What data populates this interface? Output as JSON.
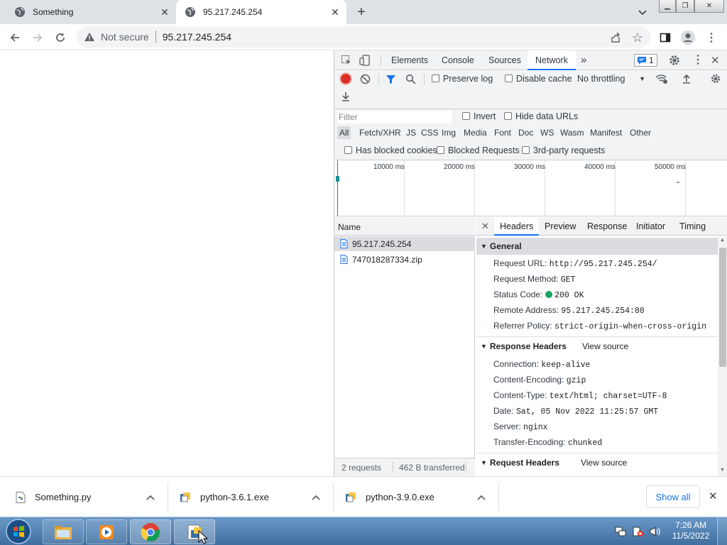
{
  "tabs": [
    {
      "title": "Something"
    },
    {
      "title": "95.217.245.254"
    }
  ],
  "addressbar": {
    "security": "Not secure",
    "url": "95.217.245.254"
  },
  "devtools": {
    "panels": [
      "Elements",
      "Console",
      "Sources",
      "Network"
    ],
    "active_panel": "Network",
    "issue_count": "1",
    "controls": {
      "preserve_log": "Preserve log",
      "disable_cache": "Disable cache",
      "throttling": "No throttling"
    },
    "filter": {
      "placeholder": "Filter",
      "invert": "Invert",
      "hide_data_urls": "Hide data URLs"
    },
    "types": [
      "All",
      "Fetch/XHR",
      "JS",
      "CSS",
      "Img",
      "Media",
      "Font",
      "Doc",
      "WS",
      "Wasm",
      "Manifest",
      "Other"
    ],
    "blocked": {
      "cookies": "Has blocked cookies",
      "requests": "Blocked Requests",
      "third_party": "3rd-party requests"
    },
    "timeline_ticks": [
      "10000 ms",
      "20000 ms",
      "30000 ms",
      "40000 ms",
      "50000 ms"
    ],
    "requests": {
      "column_name": "Name",
      "items": [
        "95.217.245.254",
        "747018287334.zip"
      ],
      "summary": "2 requests",
      "transferred": "462 B transferred"
    },
    "detail_tabs": [
      "Headers",
      "Preview",
      "Response",
      "Initiator",
      "Timing"
    ],
    "general": {
      "title": "General",
      "request_url_label": "Request URL:",
      "request_url": "http://95.217.245.254/",
      "method_label": "Request Method:",
      "method": "GET",
      "status_label": "Status Code:",
      "status": "200 OK",
      "status_color": "#1aa260",
      "remote_label": "Remote Address:",
      "remote": "95.217.245.254:80",
      "referrer_label": "Referrer Policy:",
      "referrer": "strict-origin-when-cross-origin"
    },
    "response_headers": {
      "title": "Response Headers",
      "view_source": "View source",
      "rows": [
        {
          "k": "Connection:",
          "v": "keep-alive"
        },
        {
          "k": "Content-Encoding:",
          "v": "gzip"
        },
        {
          "k": "Content-Type:",
          "v": "text/html; charset=UTF-8"
        },
        {
          "k": "Date:",
          "v": "Sat, 05 Nov 2022 11:25:57 GMT"
        },
        {
          "k": "Server:",
          "v": "nginx"
        },
        {
          "k": "Transfer-Encoding:",
          "v": "chunked"
        }
      ]
    },
    "request_headers": {
      "title": "Request Headers",
      "view_source": "View source"
    }
  },
  "downloads": {
    "items": [
      {
        "name": "Something.py"
      },
      {
        "name": "python-3.6.1.exe"
      },
      {
        "name": "python-3.9.0.exe"
      }
    ],
    "show_all": "Show all"
  },
  "taskbar": {
    "time": "7:26 AM",
    "date": "11/5/2022"
  }
}
